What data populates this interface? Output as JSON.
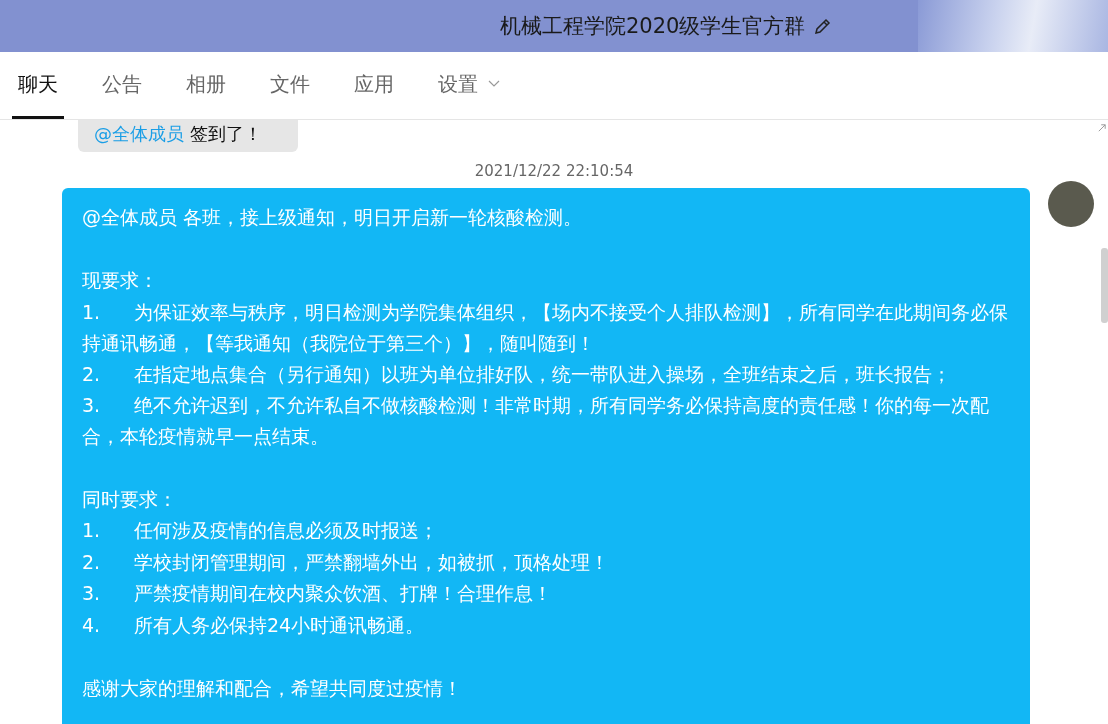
{
  "header": {
    "title": "机械工程学院2020级学生官方群"
  },
  "tabs": [
    {
      "label": "聊天",
      "selected": true,
      "kind": "tab"
    },
    {
      "label": "公告",
      "selected": false,
      "kind": "tab"
    },
    {
      "label": "相册",
      "selected": false,
      "kind": "tab"
    },
    {
      "label": "文件",
      "selected": false,
      "kind": "tab"
    },
    {
      "label": "应用",
      "selected": false,
      "kind": "tab"
    },
    {
      "label": "设置",
      "selected": false,
      "kind": "dropdown"
    }
  ],
  "previous_message": {
    "mention": "@全体成员",
    "text": "签到了！"
  },
  "timestamp": "2021/12/22 22:10:54",
  "message": {
    "lines": [
      {
        "kind": "text",
        "text": "@全体成员 各班，接上级通知，明日开启新一轮核酸检测。"
      },
      {
        "kind": "blank"
      },
      {
        "kind": "text",
        "text": "现要求："
      },
      {
        "kind": "item",
        "number": "1.",
        "text": "为保证效率与秩序，明日检测为学院集体组织，【场内不接受个人排队检测】，所有同学在此期间务必保持通讯畅通，【等我通知（我院位于第三个）】，随叫随到！"
      },
      {
        "kind": "item",
        "number": "2.",
        "text": "在指定地点集合（另行通知）以班为单位排好队，统一带队进入操场，全班结束之后，班长报告；"
      },
      {
        "kind": "item",
        "number": "3.",
        "text": "绝不允许迟到，不允许私自不做核酸检测！非常时期，所有同学务必保持高度的责任感！你的每一次配合，本轮疫情就早一点结束。"
      },
      {
        "kind": "blank"
      },
      {
        "kind": "text",
        "text": "同时要求："
      },
      {
        "kind": "item",
        "number": "1.",
        "text": "任何涉及疫情的信息必须及时报送；"
      },
      {
        "kind": "item",
        "number": "2.",
        "text": "学校封闭管理期间，严禁翻墙外出，如被抓，顶格处理！"
      },
      {
        "kind": "item",
        "number": "3.",
        "text": "严禁疫情期间在校内聚众饮酒、打牌！合理作息！"
      },
      {
        "kind": "item",
        "number": "4.",
        "text": "所有人务必保持24小时通讯畅通。"
      },
      {
        "kind": "blank"
      },
      {
        "kind": "text",
        "text": "感谢大家的理解和配合，希望共同度过疫情！"
      }
    ]
  }
}
